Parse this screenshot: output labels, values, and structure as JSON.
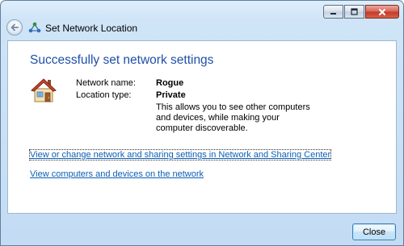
{
  "window": {
    "title": "Set Network Location",
    "controls": {
      "minimize_icon": "minimize-icon",
      "maximize_icon": "maximize-icon",
      "close_icon": "close-icon"
    }
  },
  "main": {
    "heading": "Successfully set network settings",
    "icon": "house-icon",
    "network_name_label": "Network name:",
    "network_name_value": "Rogue",
    "location_type_label": "Location type:",
    "location_type_value": "Private",
    "location_description": "This allows you to see other computers and devices, while making your computer discoverable.",
    "links": [
      "View or change network and sharing settings in Network and Sharing Center",
      "View computers and devices on the network"
    ]
  },
  "footer": {
    "close_label": "Close"
  },
  "colors": {
    "heading": "#1f4fa8",
    "link": "#0b5fb5",
    "frame": "#c3dcf3"
  }
}
